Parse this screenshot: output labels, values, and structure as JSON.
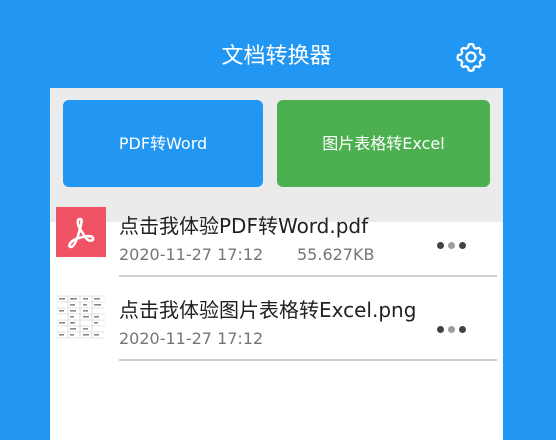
{
  "app": {
    "title": "文档转换器",
    "settings_icon": "gear-icon"
  },
  "actions": {
    "pdf_to_word": "PDF转Word",
    "image_table_to_excel": "图片表格转Excel"
  },
  "files": [
    {
      "name": "点击我体验PDF转Word.pdf",
      "date": "2020-11-27 17:12",
      "size": "55.627KB",
      "thumb_icon": "pdf-icon"
    },
    {
      "name": "点击我体验图片表格转Excel.png",
      "date": "2020-11-27 17:12",
      "size": "",
      "thumb_icon": "image-table-thumbnail"
    }
  ],
  "colors": {
    "primary": "#2196f3",
    "excel_green": "#4caf50",
    "pdf_red": "#f05464"
  }
}
